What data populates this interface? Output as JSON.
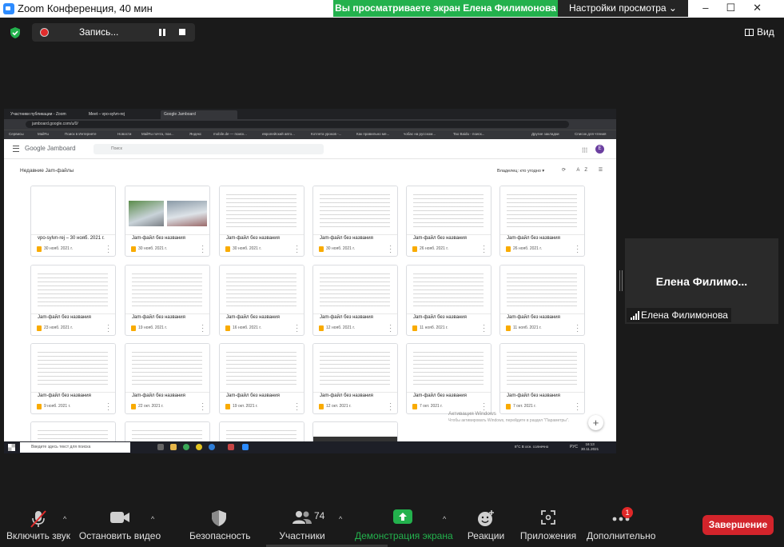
{
  "window": {
    "title": "Zoom Конференция, 40 мин",
    "controls": [
      "–",
      "☐",
      "✕"
    ]
  },
  "share_banner": {
    "text": "Вы просматриваете экран Елена Филимонова",
    "view_options": "Настройки просмотра ⌄",
    "color": "#23b14d"
  },
  "meeting_top": {
    "recording_label": "Запись...",
    "view_label": "Вид"
  },
  "browser": {
    "tabs": [
      "Участники публикации - Zoom",
      "Meet – vpo-sylvn-rej",
      "Google Jamboard"
    ],
    "url": "jamboard.google.com/u/0/",
    "bookmarks": [
      "Сервисы",
      "MailRu",
      "Поиск в Интернете",
      "Новости",
      "MailRu почта, пои...",
      "Яндекс",
      "mobile.de — поиск...",
      "европейский авто...",
      "Котлета уроков -...",
      "Как правильно ме...",
      "чобас на русском...",
      "Tao Baidu - поиск...",
      "Другие закладки",
      "Список для чтения"
    ]
  },
  "jamboard": {
    "logo": "Google Jamboard",
    "search_placeholder": "Поиск",
    "avatar_letter": "E",
    "section_title": "Недавние Jam-файлы",
    "owner_filter": "Владелец: кто угодно ▾",
    "sort_icons": "⟳ AZ ☰",
    "cards": [
      {
        "title": "vpo-sylvn-rej – 30 нояб. 2021 г.",
        "date": "30 нояб. 2021 г."
      },
      {
        "title": "Jam-файл без названия",
        "date": "30 нояб. 2021 г."
      },
      {
        "title": "Jam-файл без названия",
        "date": "30 нояб. 2021 г."
      },
      {
        "title": "Jam-файл без названия",
        "date": "30 нояб. 2021 г."
      },
      {
        "title": "Jam-файл без названия",
        "date": "26 нояб. 2021 г."
      },
      {
        "title": "Jam-файл без названия",
        "date": "26 нояб. 2021 г."
      },
      {
        "title": "Jam-файл без названия",
        "date": "23 нояб. 2021 г."
      },
      {
        "title": "Jam-файл без названия",
        "date": "19 нояб. 2021 г."
      },
      {
        "title": "Jam-файл без названия",
        "date": "16 нояб. 2021 г."
      },
      {
        "title": "Jam-файл без названия",
        "date": "12 нояб. 2021 г."
      },
      {
        "title": "Jam-файл без названия",
        "date": "11 нояб. 2021 г."
      },
      {
        "title": "Jam-файл без названия",
        "date": "11 нояб. 2021 г."
      },
      {
        "title": "Jam-файл без названия",
        "date": "9 нояб. 2021 г."
      },
      {
        "title": "Jam-файл без названия",
        "date": "22 окт. 2021 г."
      },
      {
        "title": "Jam-файл без названия",
        "date": "19 окт. 2021 г."
      },
      {
        "title": "Jam-файл без названия",
        "date": "12 окт. 2021 г."
      },
      {
        "title": "Jam-файл без названия",
        "date": "7 окт. 2021 г."
      },
      {
        "title": "Jam-файл без названия",
        "date": "7 окт. 2021 г."
      }
    ],
    "fab": "+",
    "watermark": "Активация Windows",
    "watermark_sub": "Чтобы активировать Windows, перейдите в раздел \"Параметры\"."
  },
  "taskbar": {
    "search_placeholder": "Введите здесь текст для поиска",
    "weather": "8°C  В осн. солнечно",
    "lang": "РУС",
    "time": "16:13",
    "date": "30.11.2021"
  },
  "participant": {
    "display_name_short": "Елена  Филимо...",
    "display_name": "Елена Филимонова"
  },
  "toolbar": {
    "mute": "Включить звук",
    "video": "Остановить видео",
    "security": "Безопасность",
    "participants": "Участники",
    "participants_count": "74",
    "share": "Демонстрация экрана",
    "reactions": "Реакции",
    "apps": "Приложения",
    "more": "Дополнительно",
    "more_badge": "1",
    "end": "Завершение",
    "share_color": "#23b14d",
    "end_color": "#d3242b"
  }
}
